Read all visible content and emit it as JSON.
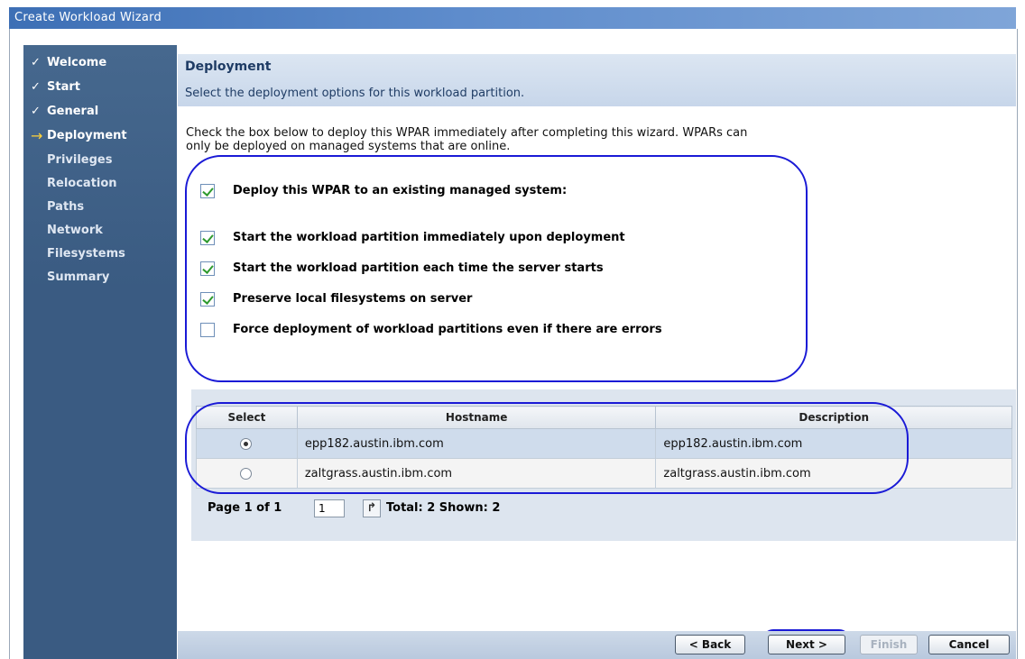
{
  "window": {
    "title": "Create Workload Wizard"
  },
  "steps": [
    {
      "label": "Welcome",
      "state": "done",
      "marker": "✓"
    },
    {
      "label": "Start",
      "state": "done",
      "marker": "✓"
    },
    {
      "label": "General",
      "state": "done",
      "marker": "✓"
    },
    {
      "label": "Deployment",
      "state": "current",
      "marker": "→"
    },
    {
      "label": "Privileges",
      "state": "pending",
      "marker": ""
    },
    {
      "label": "Relocation",
      "state": "pending",
      "marker": ""
    },
    {
      "label": "Paths",
      "state": "pending",
      "marker": ""
    },
    {
      "label": "Network",
      "state": "pending",
      "marker": ""
    },
    {
      "label": "Filesystems",
      "state": "pending",
      "marker": ""
    },
    {
      "label": "Summary",
      "state": "pending",
      "marker": ""
    }
  ],
  "page": {
    "title": "Deployment",
    "subtitle": "Select the deployment options for this workload partition.",
    "intro_line1": "Check the box below to deploy this WPAR immediately after completing this wizard.  WPARs can",
    "intro_line2": "only be deployed on managed systems that are online."
  },
  "options": [
    {
      "label": "Deploy this WPAR to an existing managed system:",
      "checked": true
    },
    {
      "label": "Start the workload partition immediately upon deployment",
      "checked": true
    },
    {
      "label": "Start the workload partition each time the server starts",
      "checked": true
    },
    {
      "label": "Preserve local filesystems on server",
      "checked": true
    },
    {
      "label": "Force deployment of workload partitions even if there are errors",
      "checked": false
    }
  ],
  "table": {
    "columns": [
      "Select",
      "Hostname",
      "Description"
    ],
    "rows": [
      {
        "selected": true,
        "hostname": "epp182.austin.ibm.com",
        "description": "epp182.austin.ibm.com"
      },
      {
        "selected": false,
        "hostname": "zaltgrass.austin.ibm.com",
        "description": "zaltgrass.austin.ibm.com"
      }
    ]
  },
  "pager": {
    "page_label": "Page 1 of 1",
    "page_value": "1",
    "summary": "Total: 2  Shown: 2"
  },
  "buttons": {
    "back": "< Back",
    "next": "Next >",
    "finish": "Finish",
    "cancel": "Cancel"
  },
  "colors": {
    "annotation": "#1a1ad6",
    "sidebar": "#3a5b82",
    "check": "#2e9a2e"
  }
}
